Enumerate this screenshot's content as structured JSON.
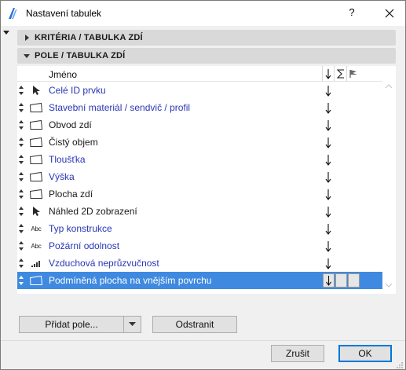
{
  "window": {
    "title": "Nastavení tabulek",
    "help_label": "?"
  },
  "sections": {
    "criteria": "KRITÉRIA / TABULKA ZDÍ",
    "fields": "POLE / TABULKA ZDÍ"
  },
  "list": {
    "header": {
      "name": "Jméno",
      "sort_icon": "sort-down-arrow-icon",
      "sum_icon": "sigma-icon",
      "flag_icon": "flag-icon"
    },
    "rows": [
      {
        "label": "Celé ID prvku",
        "icon": "cursor-arrow-icon",
        "color": "#2b35b5",
        "selected": false
      },
      {
        "label": "Stavební materiál / sendvič / profil",
        "icon": "wall-box-icon",
        "color": "#2b35b5",
        "selected": false
      },
      {
        "label": "Obvod zdí",
        "icon": "wall-box-icon",
        "color": "#1a1a1a",
        "selected": false
      },
      {
        "label": "Čistý objem",
        "icon": "wall-box-icon",
        "color": "#1a1a1a",
        "selected": false
      },
      {
        "label": "Tloušťka",
        "icon": "wall-box-icon",
        "color": "#2b35b5",
        "selected": false
      },
      {
        "label": "Výška",
        "icon": "wall-box-icon",
        "color": "#2b35b5",
        "selected": false
      },
      {
        "label": "Plocha zdí",
        "icon": "wall-box-icon",
        "color": "#1a1a1a",
        "selected": false
      },
      {
        "label": "Náhled 2D zobrazení",
        "icon": "cursor-arrow-icon",
        "color": "#1a1a1a",
        "selected": false
      },
      {
        "label": "Typ konstrukce",
        "icon": "abc-text-icon",
        "abc": "Abc",
        "color": "#2b35b5",
        "selected": false
      },
      {
        "label": "Požární odolnost",
        "icon": "abc-text-icon",
        "abc": "Abc",
        "color": "#2b35b5",
        "selected": false
      },
      {
        "label": "Vzduchová neprůzvučnost",
        "icon": "signal-bars-icon",
        "color": "#2b35b5",
        "selected": false
      },
      {
        "label": "Podmíněná plocha na vnějším povrchu",
        "icon": "wall-box-icon",
        "color": "#ffffff",
        "selected": true
      }
    ]
  },
  "buttons": {
    "add_field": "Přidat pole...",
    "remove": "Odstranit",
    "cancel": "Zrušit",
    "ok": "OK"
  },
  "colors": {
    "selection": "#3f8ae0",
    "link_text": "#2b35b5",
    "default_button_border": "#0078d7"
  }
}
